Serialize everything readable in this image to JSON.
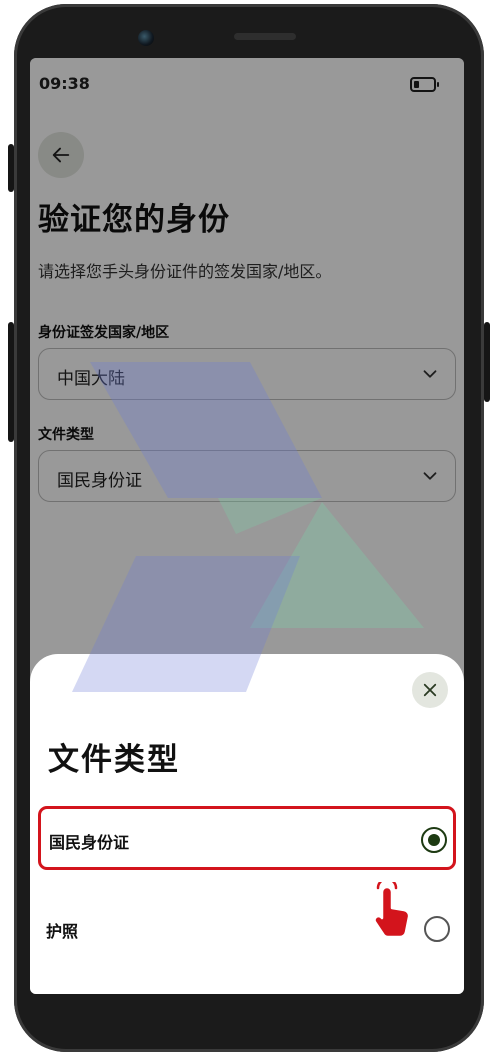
{
  "status_bar": {
    "time": "09:38"
  },
  "page": {
    "title": "验证您的身份",
    "subtitle": "请选择您手头身份证件的签发国家/地区。",
    "country_field": {
      "label": "身份证签发国家/地区",
      "value": "中国大陆"
    },
    "doc_type_field": {
      "label": "文件类型",
      "value": "国民身份证"
    }
  },
  "sheet": {
    "title": "文件类型",
    "options": [
      {
        "label": "国民身份证",
        "selected": true
      },
      {
        "label": "护照",
        "selected": false
      }
    ]
  },
  "colors": {
    "highlight": "#d3141c",
    "radio_selected": "#1d3a12",
    "icon_bg": "#e3e6df"
  },
  "icons": [
    "arrow-left-icon",
    "chevron-down-icon",
    "close-icon",
    "pointing-hand-icon",
    "battery-icon"
  ]
}
